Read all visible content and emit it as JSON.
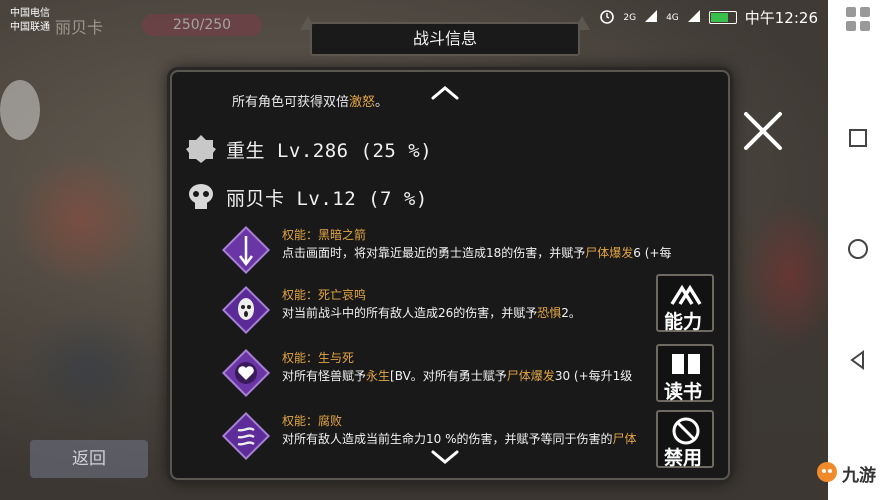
{
  "statusbar": {
    "carrier1": "中国电信",
    "carrier2": "中国联通",
    "net1": "2G",
    "net2": "4G",
    "time": "中午12:26"
  },
  "hud": {
    "name": "丽贝卡",
    "hp": "250/250"
  },
  "back_label": "返回",
  "dialog": {
    "title": "战斗信息",
    "top_note_prefix": "所有角色可获得双倍",
    "top_note_hl": "激怒",
    "top_note_suffix": "。",
    "rows": [
      {
        "icon": "gear-icon",
        "label": "重生 Lv.286 (25 %)"
      },
      {
        "icon": "skull-icon",
        "label": "丽贝卡 Lv.12 (7 %)"
      }
    ],
    "skills": [
      {
        "name": "权能：黑暗之箭",
        "desc_pre": "点击画面时，将对靠近最近的勇士造成18的伤害，并赋予",
        "desc_hl": "尸体爆发",
        "desc_post": "6 (+每",
        "icon": "arrow-icon",
        "color": "#7b3fb8"
      },
      {
        "name": "权能：死亡哀鸣",
        "desc_pre": "对当前战斗中的所有敌人造成26的伤害，并赋予",
        "desc_hl": "恐惧",
        "desc_post": "2。",
        "icon": "ghost-icon",
        "color": "#6a2fa8"
      },
      {
        "name": "权能：生与死",
        "desc_pre": "对所有怪兽赋予",
        "desc_hl": "永生",
        "desc_post": "[BV。对所有勇士赋予",
        "desc_hl2": "尸体爆发",
        "desc_post2": "30 (+每升1级",
        "icon": "heart-icon",
        "color": "#7a3db4"
      },
      {
        "name": "权能：腐败",
        "desc_pre": "对所有敌人造成当前生命力10 %的伤害，并赋予等同于伤害的",
        "desc_hl": "尸体",
        "desc_post": "",
        "icon": "corruption-icon",
        "color": "#6e34a6"
      }
    ],
    "side_buttons": [
      {
        "label": "能力",
        "icon": "upgrade-arrow-icon"
      },
      {
        "label": "读书",
        "icon": "book-icon"
      },
      {
        "label": "禁用",
        "icon": "disable-icon"
      }
    ]
  },
  "brand": "九游",
  "colors": {
    "highlight": "#e2a545",
    "skill_purple": "#7b3fb8",
    "dialog_bg": "#191919"
  }
}
